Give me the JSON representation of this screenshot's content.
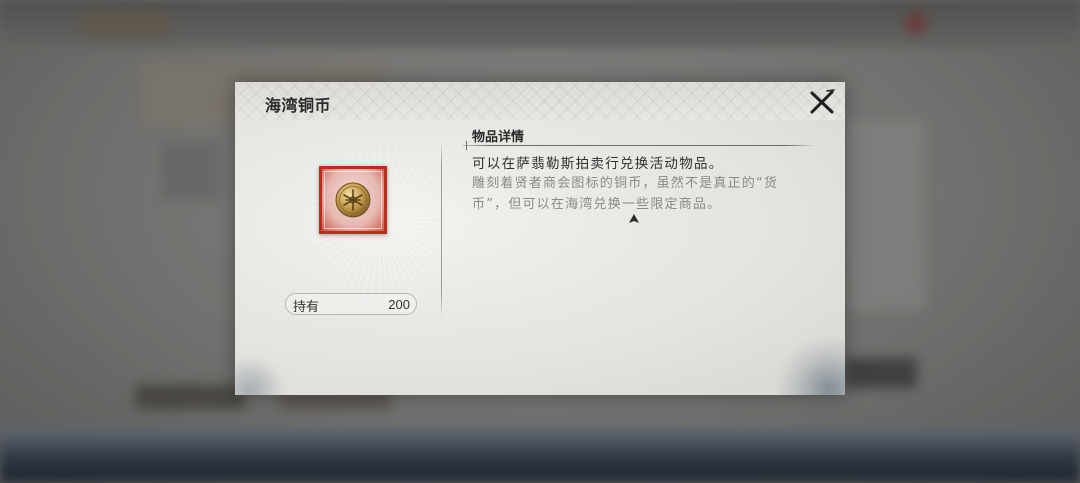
{
  "item_popup": {
    "title": "海湾铜币",
    "close_icon": "close-x-icon",
    "item_icon": "bay-copper-coin-icon",
    "item_frame_color": "#c22a1c",
    "hold_label": "持有",
    "hold_count": "200",
    "details_heading": "物品详情",
    "description": "可以在萨翡勒斯拍卖行兑换活动物品。",
    "flavor_text": "雕刻着贤者商会图标的铜币，虽然不是真正的“货币”，但可以在海湾兑换一些限定商品。"
  }
}
